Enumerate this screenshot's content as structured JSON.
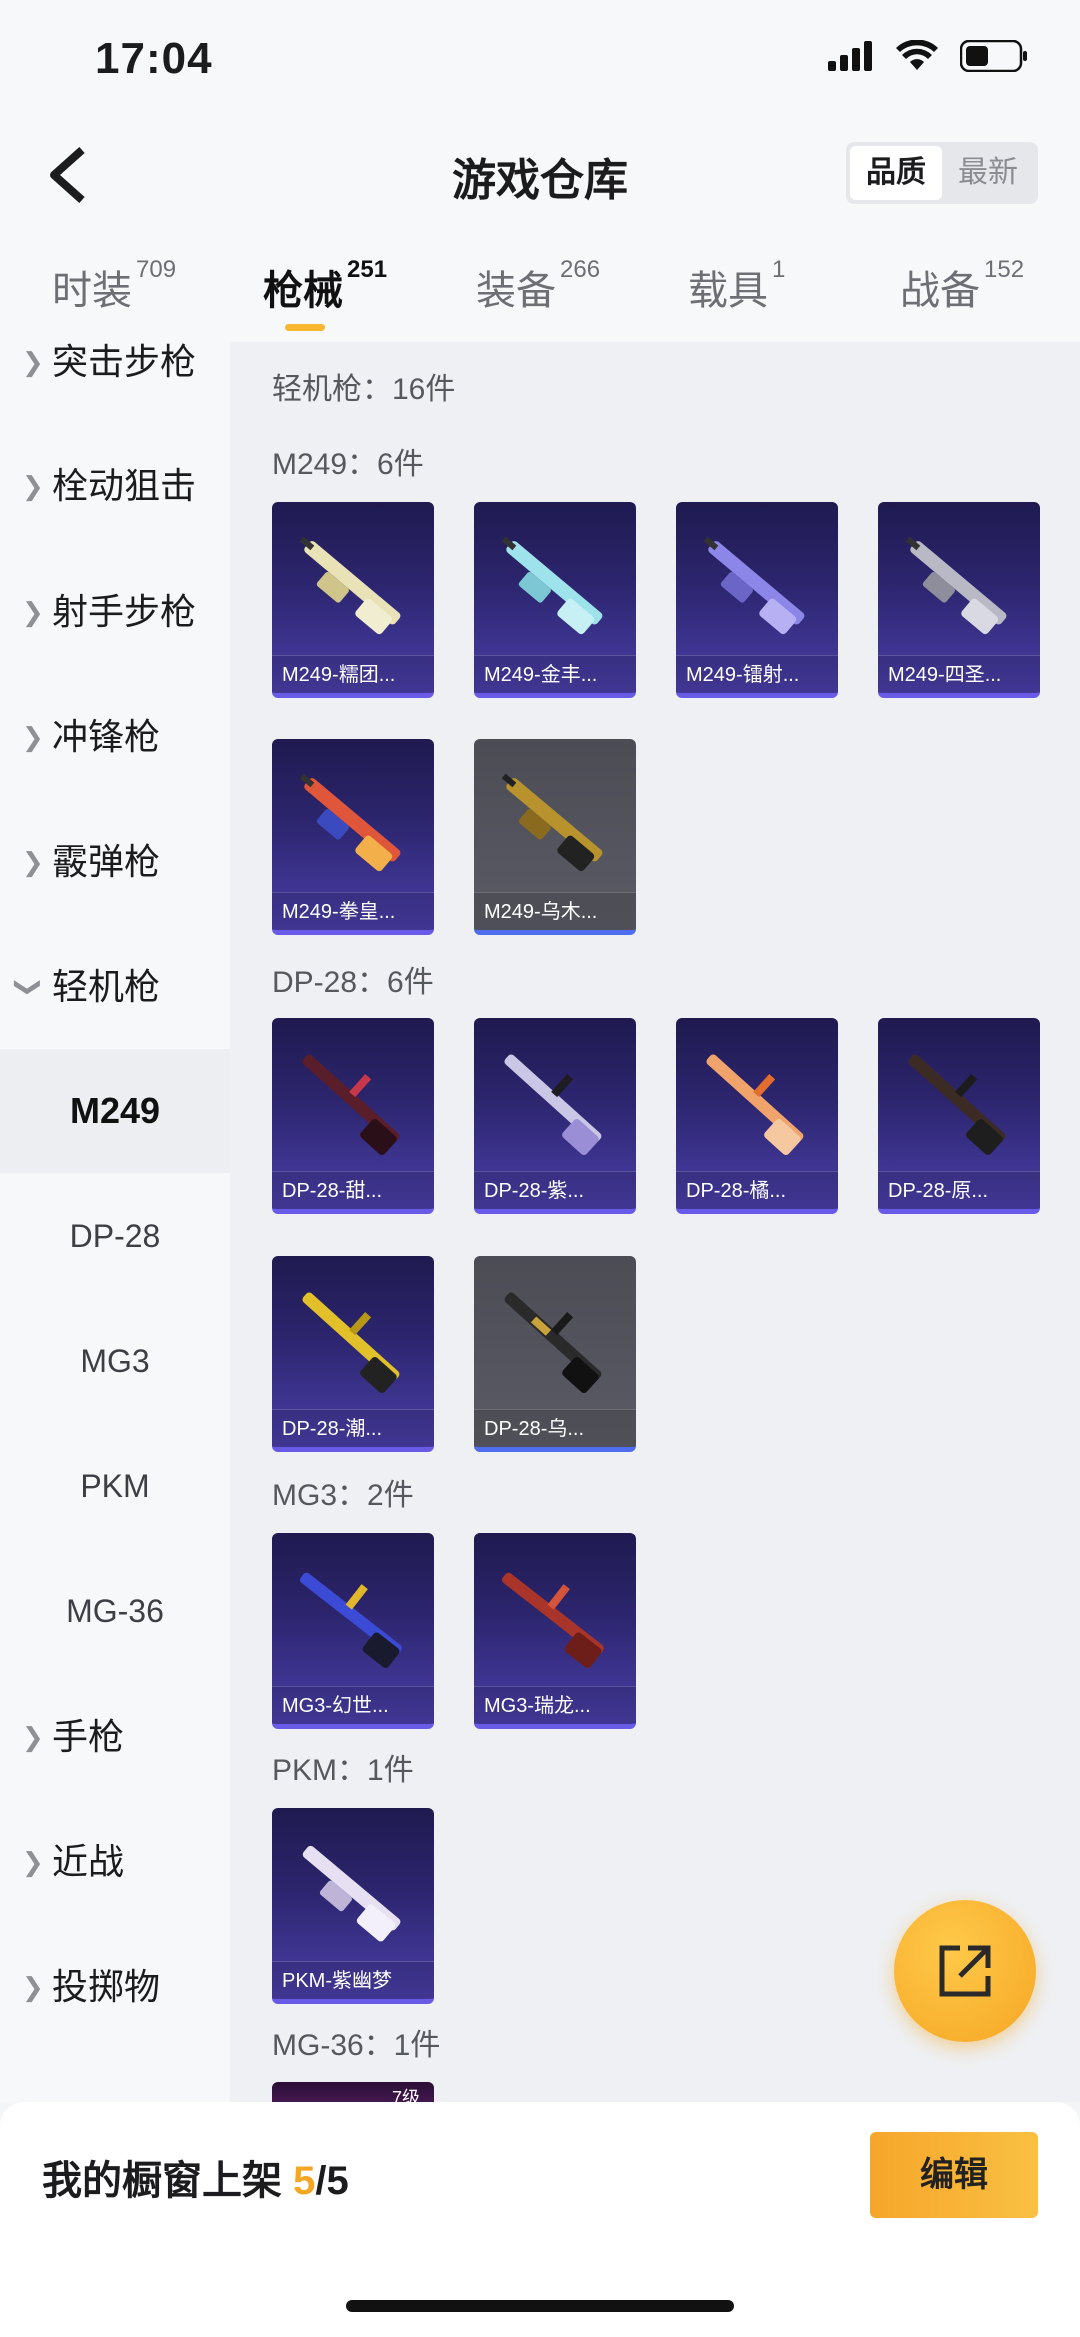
{
  "status": {
    "time": "17:04"
  },
  "header": {
    "title": "游戏仓库",
    "sort_quality": "品质",
    "sort_newest": "最新"
  },
  "tabs": [
    {
      "label": "时装",
      "count": "709"
    },
    {
      "label": "枪械",
      "count": "251"
    },
    {
      "label": "装备",
      "count": "266"
    },
    {
      "label": "载具",
      "count": "1"
    },
    {
      "label": "战备",
      "count": "152"
    }
  ],
  "sidebar": {
    "categories": [
      {
        "label": "突击步枪"
      },
      {
        "label": "栓动狙击"
      },
      {
        "label": "射手步枪"
      },
      {
        "label": "冲锋枪"
      },
      {
        "label": "霰弹枪"
      },
      {
        "label": "轻机枪"
      }
    ],
    "subitems": [
      {
        "label": "M249"
      },
      {
        "label": "DP-28"
      },
      {
        "label": "MG3"
      },
      {
        "label": "PKM"
      },
      {
        "label": "MG-36"
      }
    ],
    "categories_after": [
      {
        "label": "手枪"
      },
      {
        "label": "近战"
      },
      {
        "label": "投掷物"
      }
    ]
  },
  "content": {
    "category_heading": "轻机枪：16件",
    "groups": [
      {
        "heading": "M249：6件",
        "items": [
          "M249-糯团...",
          "M249-金丰...",
          "M249-镭射...",
          "M249-四圣...",
          "M249-拳皇...",
          "M249-乌木..."
        ]
      },
      {
        "heading": "DP-28：6件",
        "items": [
          "DP-28-甜...",
          "DP-28-紫...",
          "DP-28-橘...",
          "DP-28-原...",
          "DP-28-潮...",
          "DP-28-乌..."
        ]
      },
      {
        "heading": "MG3：2件",
        "items": [
          "MG3-幻世...",
          "MG3-瑞龙..."
        ]
      },
      {
        "heading": "PKM：1件",
        "items": [
          "PKM-紫幽梦"
        ]
      },
      {
        "heading": "MG-36：1件",
        "items": []
      }
    ],
    "partial_card_badge": "7级"
  },
  "footer": {
    "label_prefix": "我的橱窗上架",
    "shown": "5",
    "total": "/5",
    "edit": "编辑"
  },
  "colors": {
    "accent": "#f5a623",
    "card_purple": "#2d2670",
    "card_gray": "#55555f"
  }
}
